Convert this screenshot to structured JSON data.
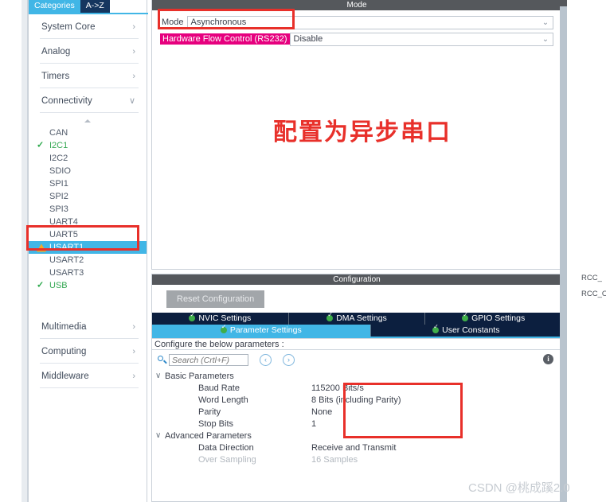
{
  "sidebar": {
    "tabs": [
      {
        "label": "Categories",
        "active": true
      },
      {
        "label": "A->Z",
        "active": false
      }
    ],
    "categories": [
      {
        "label": "System Core",
        "chevron": "›",
        "expanded": false
      },
      {
        "label": "Analog",
        "chevron": "›",
        "expanded": false
      },
      {
        "label": "Timers",
        "chevron": "›",
        "expanded": false
      },
      {
        "label": "Connectivity",
        "chevron": "∨",
        "expanded": true
      }
    ],
    "connectivity_items": [
      {
        "label": "CAN",
        "state": "none"
      },
      {
        "label": "I2C1",
        "state": "ok"
      },
      {
        "label": "I2C2",
        "state": "none"
      },
      {
        "label": "SDIO",
        "state": "none"
      },
      {
        "label": "SPI1",
        "state": "none"
      },
      {
        "label": "SPI2",
        "state": "none"
      },
      {
        "label": "SPI3",
        "state": "none"
      },
      {
        "label": "UART4",
        "state": "none"
      },
      {
        "label": "UART5",
        "state": "none"
      },
      {
        "label": "USART1",
        "state": "warning",
        "selected": true
      },
      {
        "label": "USART2",
        "state": "none"
      },
      {
        "label": "USART3",
        "state": "none"
      },
      {
        "label": "USB",
        "state": "ok"
      }
    ],
    "categories_bottom": [
      {
        "label": "Multimedia",
        "chevron": "›"
      },
      {
        "label": "Computing",
        "chevron": "›"
      },
      {
        "label": "Middleware",
        "chevron": "›"
      }
    ]
  },
  "mode_panel": {
    "title": "Mode",
    "rows": [
      {
        "label": "Mode",
        "value": "Asynchronous",
        "highlight": false
      },
      {
        "label": "Hardware Flow Control (RS232)",
        "value": "Disable",
        "highlight": true
      }
    ],
    "annotation_text": "配置为异步串口"
  },
  "config_panel": {
    "title": "Configuration",
    "reset_label": "Reset Configuration",
    "tabs_row1": [
      {
        "label": "NVIC Settings",
        "active": false
      },
      {
        "label": "DMA Settings",
        "active": false
      },
      {
        "label": "GPIO Settings",
        "active": false
      }
    ],
    "tabs_row2": [
      {
        "label": "Parameter Settings",
        "active": true
      },
      {
        "label": "User Constants",
        "active": false
      }
    ],
    "hint": "Configure the below parameters :",
    "search_placeholder": "Search (Crtl+F)",
    "nav_prev": "‹",
    "nav_next": "›",
    "info_glyph": "i",
    "groups": [
      {
        "name": "Basic Parameters",
        "chevron": "∨",
        "params": [
          {
            "name": "Baud Rate",
            "value": "115200 Bits/s",
            "dim": false
          },
          {
            "name": "Word Length",
            "value": "8 Bits (including Parity)",
            "dim": false
          },
          {
            "name": "Parity",
            "value": "None",
            "dim": false
          },
          {
            "name": "Stop Bits",
            "value": "1",
            "dim": false
          }
        ]
      },
      {
        "name": "Advanced Parameters",
        "chevron": "∨",
        "params": [
          {
            "name": "Data Direction",
            "value": "Receive and Transmit",
            "dim": false
          },
          {
            "name": "Over Sampling",
            "value": "16 Samples",
            "dim": true
          }
        ]
      }
    ]
  },
  "right_stub": {
    "line1": "RCC_",
    "line2": "RCC_OS"
  },
  "watermark": "CSDN @桃成蹊2.0",
  "colors": {
    "accent_blue": "#41b6e6",
    "tab_navy": "#0c1f3f",
    "annotation_red": "#e8302a",
    "highlight_magenta": "#e6007e",
    "ok_green": "#2aa84a",
    "warning_orange": "#f5a623",
    "panel_header_gray": "#55585c"
  }
}
